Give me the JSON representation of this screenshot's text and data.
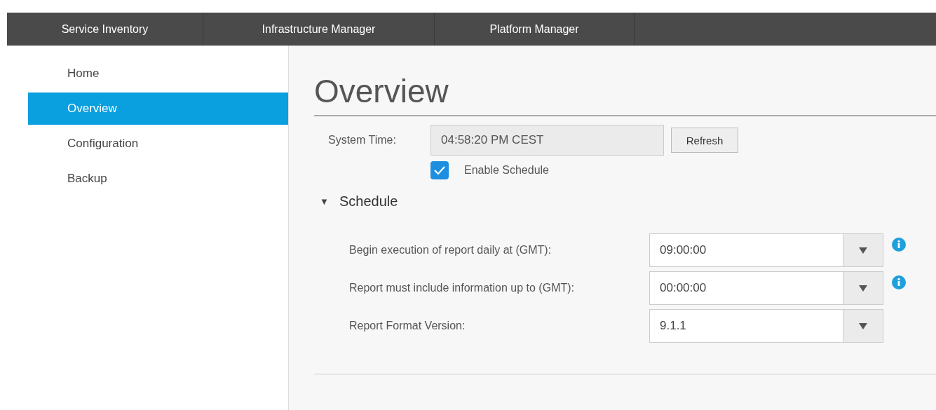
{
  "nav_tabs": [
    {
      "label": "Service Inventory",
      "selected": false
    },
    {
      "label": "Infrastructure Manager",
      "selected": false
    },
    {
      "label": "Platform Manager",
      "selected": false
    }
  ],
  "sidebar": {
    "items": [
      {
        "label": "Home",
        "selected": false
      },
      {
        "label": "Overview",
        "selected": true
      },
      {
        "label": "Configuration",
        "selected": false
      },
      {
        "label": "Backup",
        "selected": false
      }
    ]
  },
  "page_title": "Overview",
  "system_time": {
    "label": "System Time:",
    "value": "04:58:20 PM CEST",
    "button": "Refresh"
  },
  "enable_schedule": {
    "label": "Enable Schedule",
    "checked": true
  },
  "schedule": {
    "title": "Schedule",
    "expanded": true,
    "toggle": "▼",
    "fields": [
      {
        "label": "Begin execution of report daily at (GMT):",
        "value": "09:00:00",
        "info": true
      },
      {
        "label": "Report must include information up to (GMT):",
        "value": "00:00:00",
        "info": true
      },
      {
        "label": "Report Format Version:",
        "value": "9.1.1",
        "info": false
      }
    ]
  }
}
